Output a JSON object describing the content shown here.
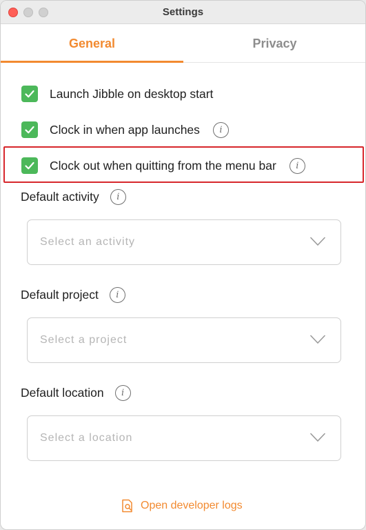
{
  "window": {
    "title": "Settings"
  },
  "tabs": [
    {
      "label": "General",
      "active": true
    },
    {
      "label": "Privacy",
      "active": false
    }
  ],
  "options": [
    {
      "label": "Launch Jibble on desktop start",
      "checked": true,
      "has_info": false
    },
    {
      "label": "Clock in when app launches",
      "checked": true,
      "has_info": true
    },
    {
      "label": "Clock out when quitting from the menu bar",
      "checked": true,
      "has_info": true,
      "highlighted": true
    }
  ],
  "defaults": {
    "activity": {
      "label": "Default activity",
      "placeholder": "Select an activity"
    },
    "project": {
      "label": "Default project",
      "placeholder": "Select a project"
    },
    "location": {
      "label": "Default location",
      "placeholder": "Select a location"
    }
  },
  "footer": {
    "dev_logs_label": "Open developer logs",
    "icon": "log-search-icon"
  },
  "colors": {
    "accent": "#f28a30",
    "check_green": "#4cb85a",
    "highlight_red": "#d7262b",
    "close_button": "#ff5f57"
  },
  "icons": {
    "info": "info-icon",
    "check": "checkmark-icon",
    "dropdown": "chevron-down-icon"
  }
}
